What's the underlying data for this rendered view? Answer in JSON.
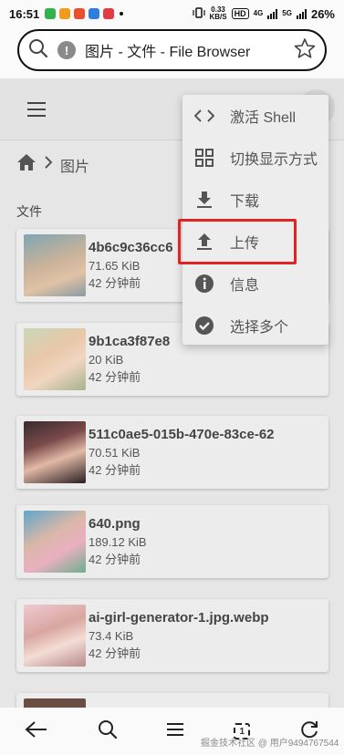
{
  "status_bar": {
    "time": "16:51",
    "net_speed_value": "0.33",
    "net_speed_unit": "KB/S",
    "hd_label": "HD",
    "net_a": "4G",
    "net_b": "5G",
    "battery": "26%"
  },
  "browser": {
    "url_title": "图片 - 文件 - File Browser"
  },
  "breadcrumb": {
    "current": "图片"
  },
  "section_title": "文件",
  "files": [
    {
      "name": "4b6c9c36cc6",
      "size": "71.65 KiB",
      "modified": "42 分钟前"
    },
    {
      "name": "9b1ca3f87e8",
      "size": "20 KiB",
      "modified": "42 分钟前"
    },
    {
      "name": "511c0ae5-015b-470e-83ce-62",
      "size": "70.51 KiB",
      "modified": "42 分钟前"
    },
    {
      "name": "640.png",
      "size": "189.12 KiB",
      "modified": "42 分钟前"
    },
    {
      "name": "ai-girl-generator-1.jpg.webp",
      "size": "73.4 KiB",
      "modified": "42 分钟前"
    }
  ],
  "menu": {
    "items": [
      {
        "label": "激活 Shell",
        "icon": "code-icon"
      },
      {
        "label": "切换显示方式",
        "icon": "grid-view-icon"
      },
      {
        "label": "下载",
        "icon": "download-icon"
      },
      {
        "label": "上传",
        "icon": "upload-icon"
      },
      {
        "label": "信息",
        "icon": "info-icon"
      },
      {
        "label": "选择多个",
        "icon": "check-circle-icon"
      }
    ],
    "highlighted_item": "上传",
    "highlight_color": "#e02424"
  },
  "bottom_nav": {
    "tab_count": "1"
  },
  "watermark": "掘金技术社区 @ 用户9494767544"
}
